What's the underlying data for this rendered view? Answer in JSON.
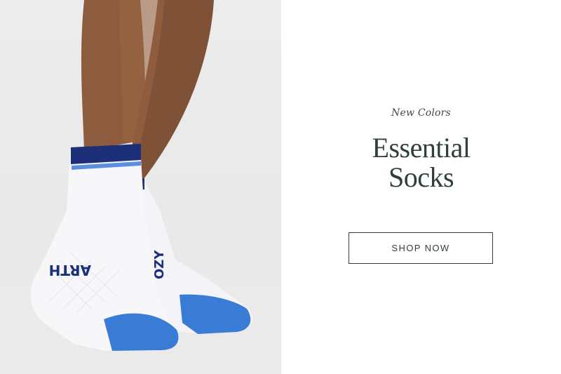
{
  "banner": {
    "eyebrow": "New Colors",
    "headline_line1": "Essential",
    "headline_line2": "Socks",
    "cta_label": "SHOP NOW"
  },
  "colors": {
    "text": "#2f3f3e",
    "sock_white": "#f7f7fa",
    "sock_navy": "#1e2f7a",
    "sock_blue": "#3a7bd5",
    "skin": "#8b5a3c"
  },
  "photo": {
    "sock_print_left": "ARTH",
    "sock_print_right": "OZY"
  }
}
